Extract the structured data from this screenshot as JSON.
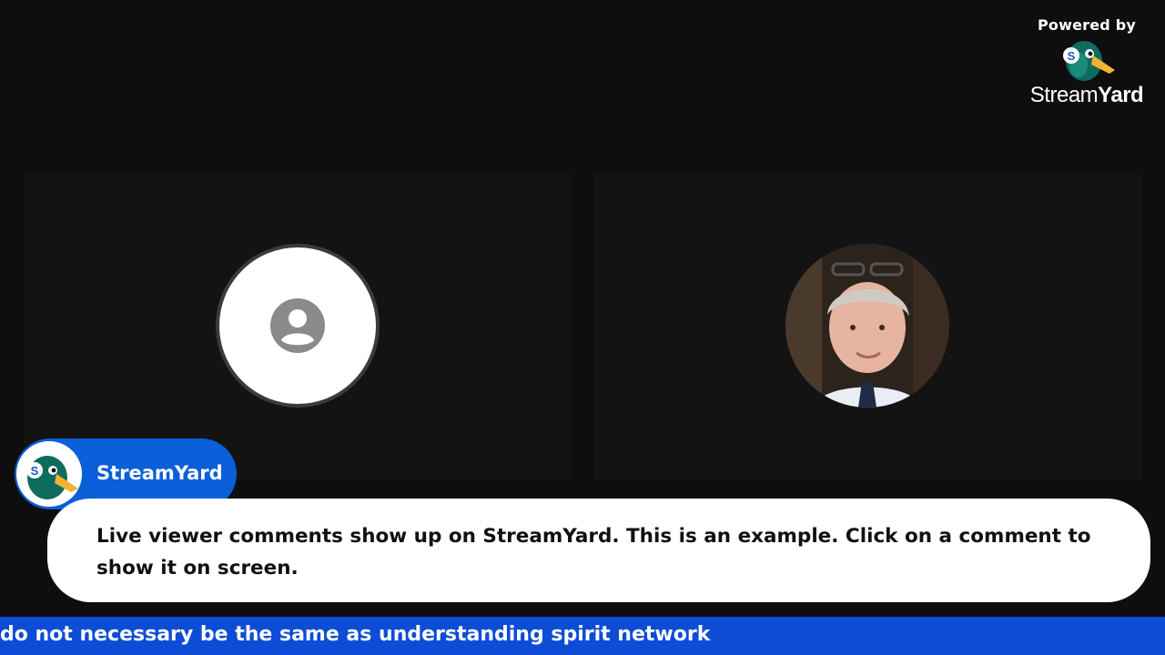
{
  "watermark": {
    "powered_by": "Powered by",
    "brand_light": "Stream",
    "brand_bold": "Yard"
  },
  "participants": [
    {
      "type": "placeholder",
      "icon": "person-icon"
    },
    {
      "type": "photo"
    }
  ],
  "comment": {
    "author": "StreamYard",
    "text": "Live viewer comments show up on StreamYard. This is an example. Click on a comment to show it on screen."
  },
  "ticker": {
    "text": "do not necessary be the same as understanding spirit network"
  },
  "colors": {
    "background": "#0e0e0e",
    "tile": "#131313",
    "badge": "#0b5fd8",
    "ticker": "#0d4dd6",
    "bubble": "#ffffff"
  }
}
